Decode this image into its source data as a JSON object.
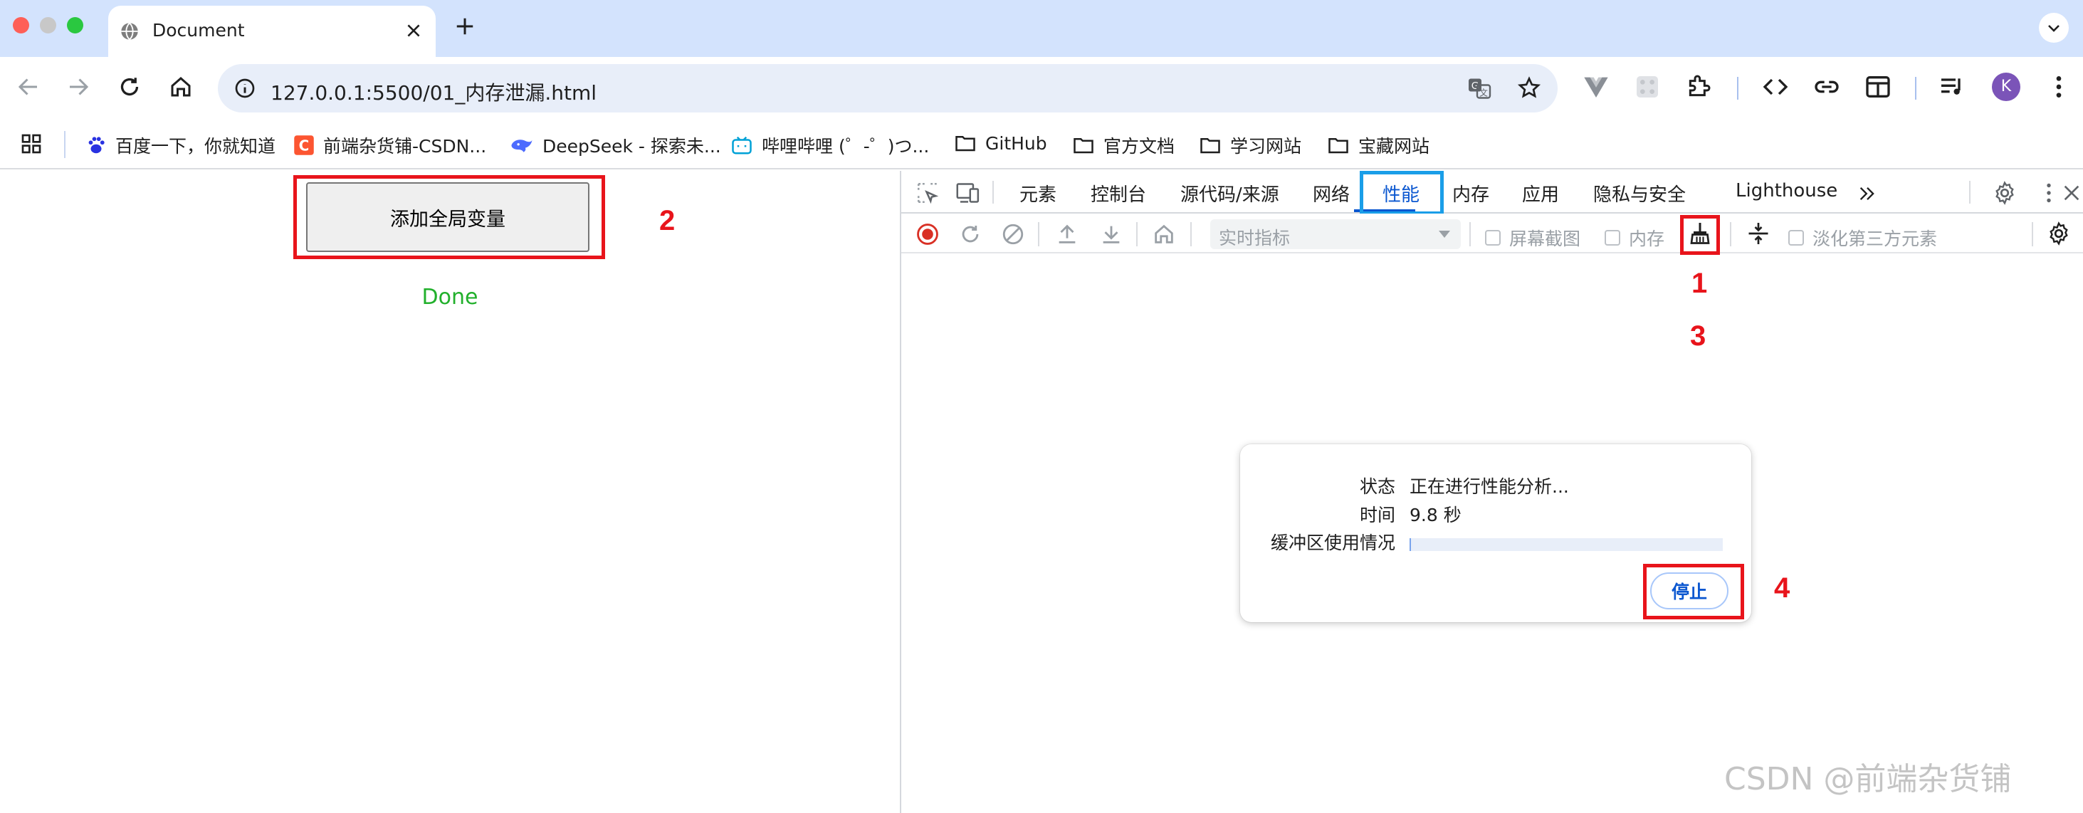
{
  "tab": {
    "title": "Document"
  },
  "address_bar": {
    "url": "127.0.0.1:5500/01_内存泄漏.html"
  },
  "profile": {
    "initial": "K",
    "color": "#7b54b8"
  },
  "bookmarks": [
    {
      "label": "百度一下，你就知道",
      "icon": "baidu-paw-icon"
    },
    {
      "label": "前端杂货铺-CSDN...",
      "icon": "csdn-logo-icon"
    },
    {
      "label": "DeepSeek - 探索未...",
      "icon": "deepseek-whale-icon"
    },
    {
      "label": "哔哩哔哩 (゜-゜)つ...",
      "icon": "bilibili-tv-icon"
    },
    {
      "label": "GitHub",
      "icon": "folder-icon"
    },
    {
      "label": "官方文档",
      "icon": "folder-icon"
    },
    {
      "label": "学习网站",
      "icon": "folder-icon"
    },
    {
      "label": "宝藏网站",
      "icon": "folder-icon"
    }
  ],
  "page": {
    "button_label": "添加全局变量",
    "status_text": "Done",
    "status_color": "#22b02c"
  },
  "devtools": {
    "tabs": [
      "元素",
      "控制台",
      "源代码/来源",
      "网络",
      "性能",
      "内存",
      "应用",
      "隐私与安全",
      "Lighthouse"
    ],
    "active_tab": "性能",
    "toolbar": {
      "metric_select": "实时指标",
      "checkbox_screenshots": "屏幕截图",
      "checkbox_memory": "内存",
      "checkbox_dim_third_party": "淡化第三方元素"
    },
    "dialog": {
      "status_label": "状态",
      "status_value": "正在进行性能分析...",
      "time_label": "时间",
      "time_value": "9.8 秒",
      "buffer_label": "缓冲区使用情况",
      "buffer_fraction": 0.005,
      "stop_label": "停止"
    }
  },
  "annotations": {
    "a1": "1",
    "a2": "2",
    "a3": "3",
    "a4": "4",
    "color": "#e8141b",
    "tab_highlight_color": "#1a9ee8"
  },
  "watermark": "CSDN @前端杂货铺"
}
